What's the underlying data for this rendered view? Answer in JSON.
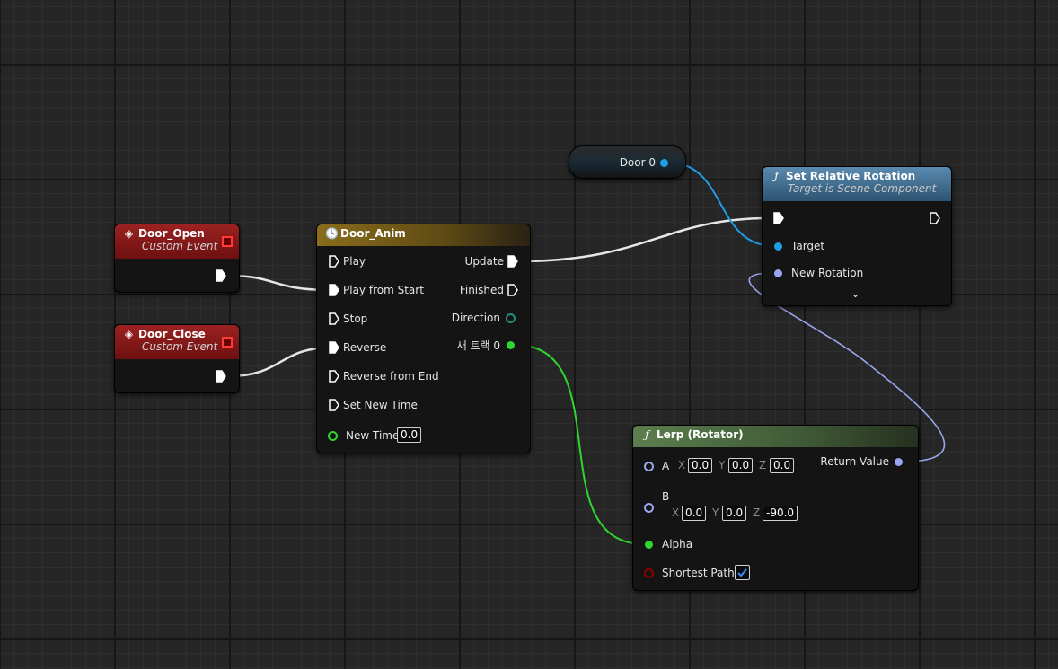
{
  "events": {
    "open": {
      "title": "Door_Open",
      "subtitle": "Custom Event"
    },
    "close": {
      "title": "Door_Close",
      "subtitle": "Custom Event"
    }
  },
  "timeline": {
    "title": "Door_Anim",
    "inputs": [
      "Play",
      "Play from Start",
      "Stop",
      "Reverse",
      "Reverse from End",
      "Set New Time"
    ],
    "new_time_label": "New Time",
    "new_time_value": "0.0",
    "outputs": {
      "update": "Update",
      "finished": "Finished",
      "direction": "Direction",
      "track": "새 트랙 0"
    }
  },
  "variable": {
    "label": "Door 0"
  },
  "set_rotation": {
    "title": "Set Relative Rotation",
    "subtitle": "Target is Scene Component",
    "target": "Target",
    "new_rotation": "New Rotation",
    "expand_icon": "chevron-down-icon"
  },
  "lerp": {
    "title": "Lerp (Rotator)",
    "a_label": "A",
    "b_label": "B",
    "axes": [
      "X",
      "Y",
      "Z"
    ],
    "a_values": [
      "0.0",
      "0.0",
      "0.0"
    ],
    "b_values": [
      "0.0",
      "0.0",
      "-90.0"
    ],
    "alpha": "Alpha",
    "shortest_path": "Shortest Path",
    "shortest_path_checked": true,
    "return_value": "Return Value"
  },
  "colors": {
    "event_header": "#8b1a1a",
    "timeline_header": "#8a6d1c",
    "function_header": "#3f6f8a",
    "lerp_header": "#4c6c3e",
    "exec_wire": "#ffffff",
    "object_pin": "#1e9ee6",
    "rotator_pin": "#9aa5ee",
    "float_pin": "#2ed62e",
    "bool_pin": "#8c0000"
  }
}
